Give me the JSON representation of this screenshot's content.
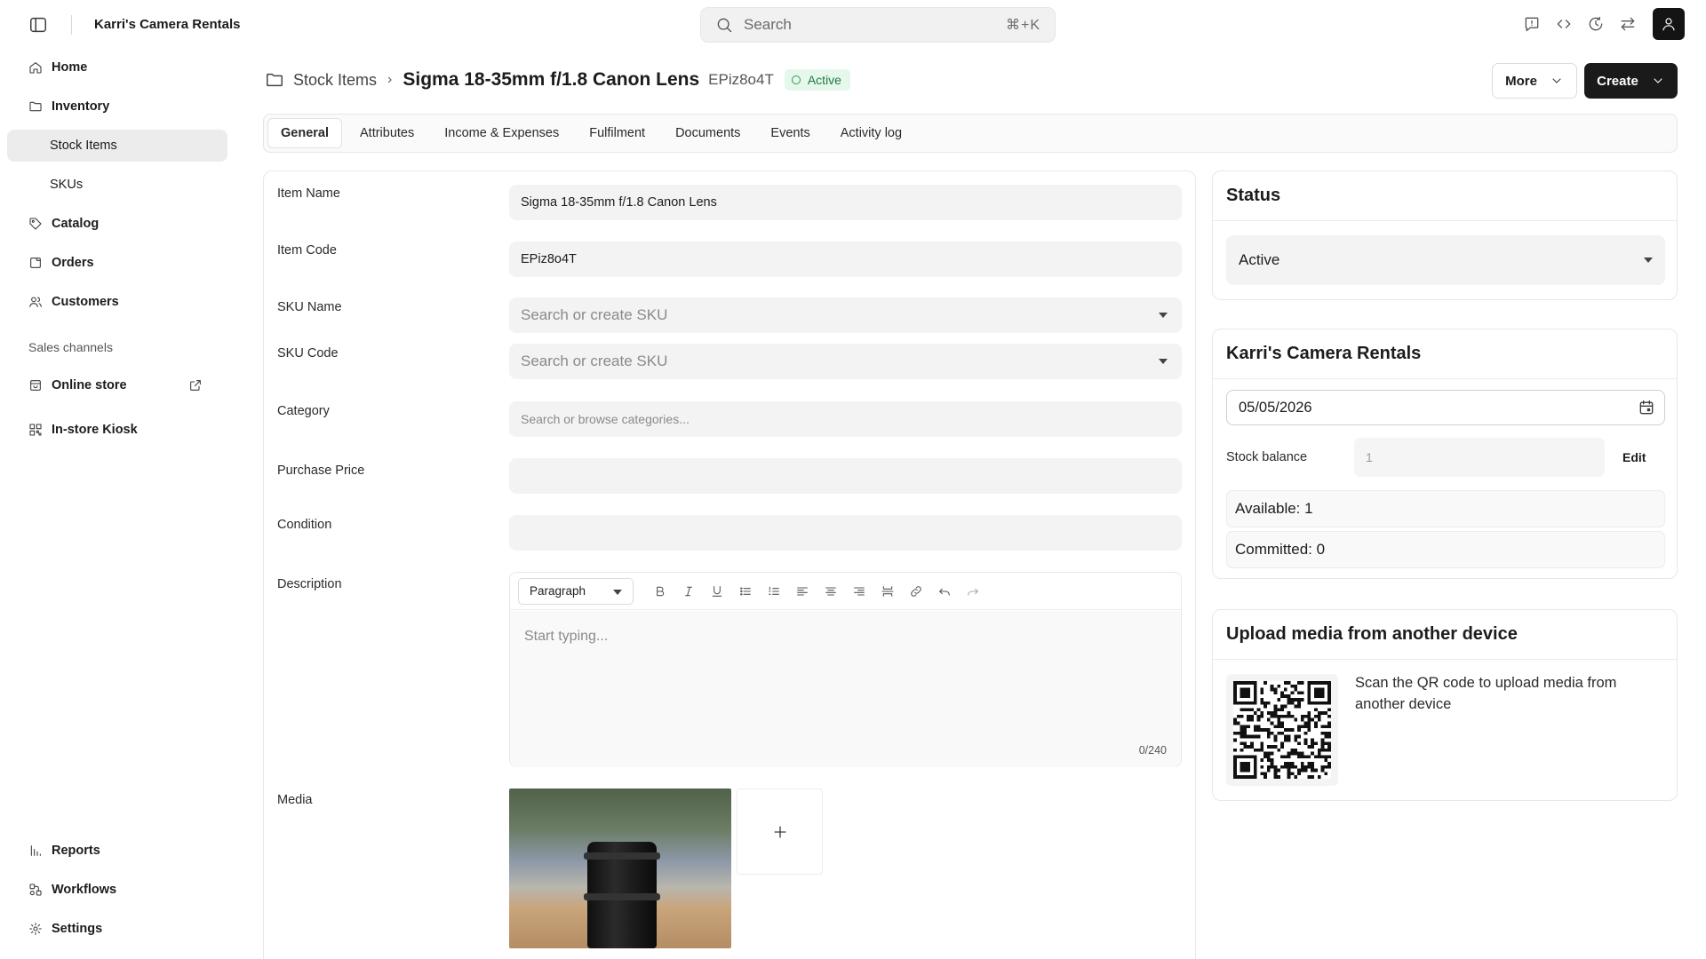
{
  "app": {
    "store_name": "Karri's Camera Rentals",
    "search": {
      "label": "Search",
      "shortcut": "⌘+K"
    },
    "topbar_icons": [
      "feedback-icon",
      "code-icon",
      "history-icon",
      "switch-icon"
    ],
    "avatar_icon": "user-icon"
  },
  "sidebar": {
    "items": [
      {
        "label": "Home",
        "icon": "home-icon"
      },
      {
        "label": "Inventory",
        "icon": "folder-icon"
      },
      {
        "label": "Stock Items",
        "active": true
      },
      {
        "label": "SKUs"
      },
      {
        "label": "Catalog",
        "icon": "tag-icon"
      },
      {
        "label": "Orders",
        "icon": "orders-icon"
      },
      {
        "label": "Customers",
        "icon": "customers-icon"
      }
    ],
    "sales_channels_label": "Sales channels",
    "channels": [
      {
        "label": "Online store",
        "icon": "store-icon",
        "external": true
      },
      {
        "label": "In-store Kiosk",
        "icon": "kiosk-icon"
      }
    ],
    "bottom": [
      {
        "label": "Reports",
        "icon": "reports-icon"
      },
      {
        "label": "Workflows",
        "icon": "workflows-icon"
      },
      {
        "label": "Settings",
        "icon": "gear-icon"
      }
    ]
  },
  "header": {
    "breadcrumb_parent": "Stock Items",
    "title": "Sigma 18-35mm f/1.8 Canon Lens",
    "code": "EPiz8o4T",
    "status_badge": "Active",
    "more_label": "More",
    "create_label": "Create"
  },
  "tabs": [
    "General",
    "Attributes",
    "Income & Expenses",
    "Fulfilment",
    "Documents",
    "Events",
    "Activity log"
  ],
  "form": {
    "item_name": {
      "label": "Item Name",
      "value": "Sigma 18-35mm f/1.8 Canon Lens"
    },
    "item_code": {
      "label": "Item Code",
      "value": "EPiz8o4T"
    },
    "sku_name": {
      "label": "SKU Name",
      "placeholder": "Search or create SKU"
    },
    "sku_code": {
      "label": "SKU Code",
      "placeholder": "Search or create SKU"
    },
    "category": {
      "label": "Category",
      "placeholder": "Search or browse categories..."
    },
    "purchase_price": {
      "label": "Purchase Price",
      "value": ""
    },
    "condition": {
      "label": "Condition",
      "value": ""
    },
    "description": {
      "label": "Description",
      "block_type": "Paragraph",
      "placeholder": "Start typing...",
      "char_count": "0/240"
    },
    "media": {
      "label": "Media",
      "add_symbol": "+"
    }
  },
  "status_card": {
    "title": "Status",
    "value": "Active"
  },
  "location_card": {
    "title": "Karri's Camera Rentals",
    "date": "05/05/2026",
    "stock_balance_label": "Stock balance",
    "stock_balance_value": "1",
    "edit_label": "Edit",
    "available": "Available: 1",
    "committed": "Committed: 0"
  },
  "upload_card": {
    "title": "Upload media from another device",
    "text": "Scan the QR code to upload media from another device"
  }
}
